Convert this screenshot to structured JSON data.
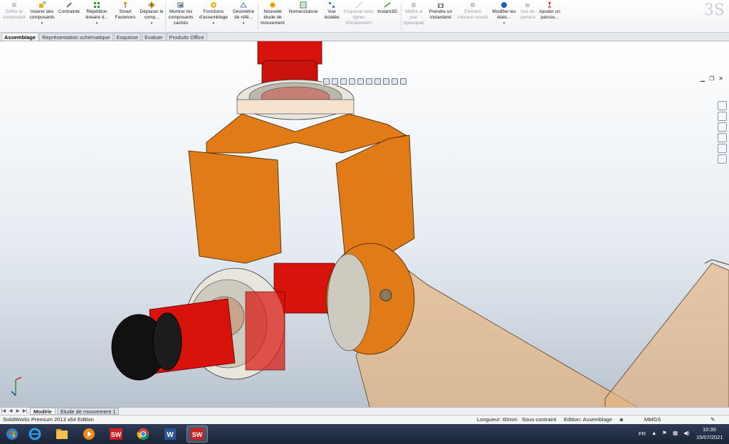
{
  "ribbon": {
    "buttons": [
      {
        "label": "Editer le composant",
        "icon": "edit-component-icon",
        "disabled": true
      },
      {
        "label": "Insérer des composants",
        "icon": "insert-components-icon",
        "disabled": false
      },
      {
        "label": "Contrainte",
        "icon": "mate-icon",
        "disabled": false
      },
      {
        "label": "Répétition linéaire d...",
        "icon": "linear-pattern-icon",
        "disabled": false
      },
      {
        "label": "Smart Fasteners",
        "icon": "smart-fasteners-icon",
        "disabled": false
      },
      {
        "label": "Déplacer le comp...",
        "icon": "move-component-icon",
        "disabled": false
      },
      {
        "label": "Montrer les composants cachés",
        "icon": "show-hidden-icon",
        "disabled": false
      },
      {
        "label": "Fonctions d'assemblage",
        "icon": "assembly-features-icon",
        "disabled": false
      },
      {
        "label": "Géométrie de réfé...",
        "icon": "reference-geometry-icon",
        "disabled": false
      },
      {
        "label": "Nouvelle étude de mouvement",
        "icon": "motion-study-icon",
        "disabled": false
      },
      {
        "label": "Nomenclature",
        "icon": "bom-icon",
        "disabled": false
      },
      {
        "label": "Vue éclatée",
        "icon": "exploded-view-icon",
        "disabled": false
      },
      {
        "label": "Esquisse avec lignes d'éclatement",
        "icon": "explode-line-sketch-icon",
        "disabled": true
      },
      {
        "label": "Instant3D",
        "icon": "instant3d-icon",
        "disabled": false
      },
      {
        "label": "Mettre à jour Speedpak",
        "icon": "speedpak-icon",
        "disabled": true
      },
      {
        "label": "Prendre un instantané",
        "icon": "snapshot-icon",
        "disabled": false
      },
      {
        "label": "Elément mécano-soudé",
        "icon": "weldment-icon",
        "disabled": true
      },
      {
        "label": "Modifier les états...",
        "icon": "display-states-icon",
        "disabled": false
      },
      {
        "label": "Vue de caméra",
        "icon": "camera-view-icon",
        "disabled": true
      },
      {
        "label": "Ajouter un parcou...",
        "icon": "add-walkthrough-icon",
        "disabled": false
      }
    ]
  },
  "tabs": [
    {
      "label": "Assemblage",
      "active": true
    },
    {
      "label": "Représentation schématique",
      "active": false
    },
    {
      "label": "Esquisse",
      "active": false
    },
    {
      "label": "Evaluer",
      "active": false
    },
    {
      "label": "Produits Office",
      "active": false
    }
  ],
  "model_tabs": [
    {
      "label": "Modèle",
      "active": true
    },
    {
      "label": "Etude de mouvement 1",
      "active": false
    }
  ],
  "status": {
    "app": "SolidWorks Premium 2013 x64 Edition",
    "length": "Longueur: 60mm",
    "constraint": "Sous-contraint",
    "mode": "Edition: Assemblage",
    "units": "MMGS"
  },
  "taskbar": {
    "language": "FR",
    "time": "10:30",
    "date": "15/07/2021",
    "apps": [
      "start-icon",
      "internet-explorer-icon",
      "file-explorer-icon",
      "media-player-icon",
      "solidworks-icon",
      "chrome-icon",
      "word-icon",
      "solidworks-active-icon"
    ]
  },
  "colors": {
    "orange": "#e07b17",
    "red": "#d8130c",
    "black": "#111111",
    "ring": "#d9d6cc"
  }
}
